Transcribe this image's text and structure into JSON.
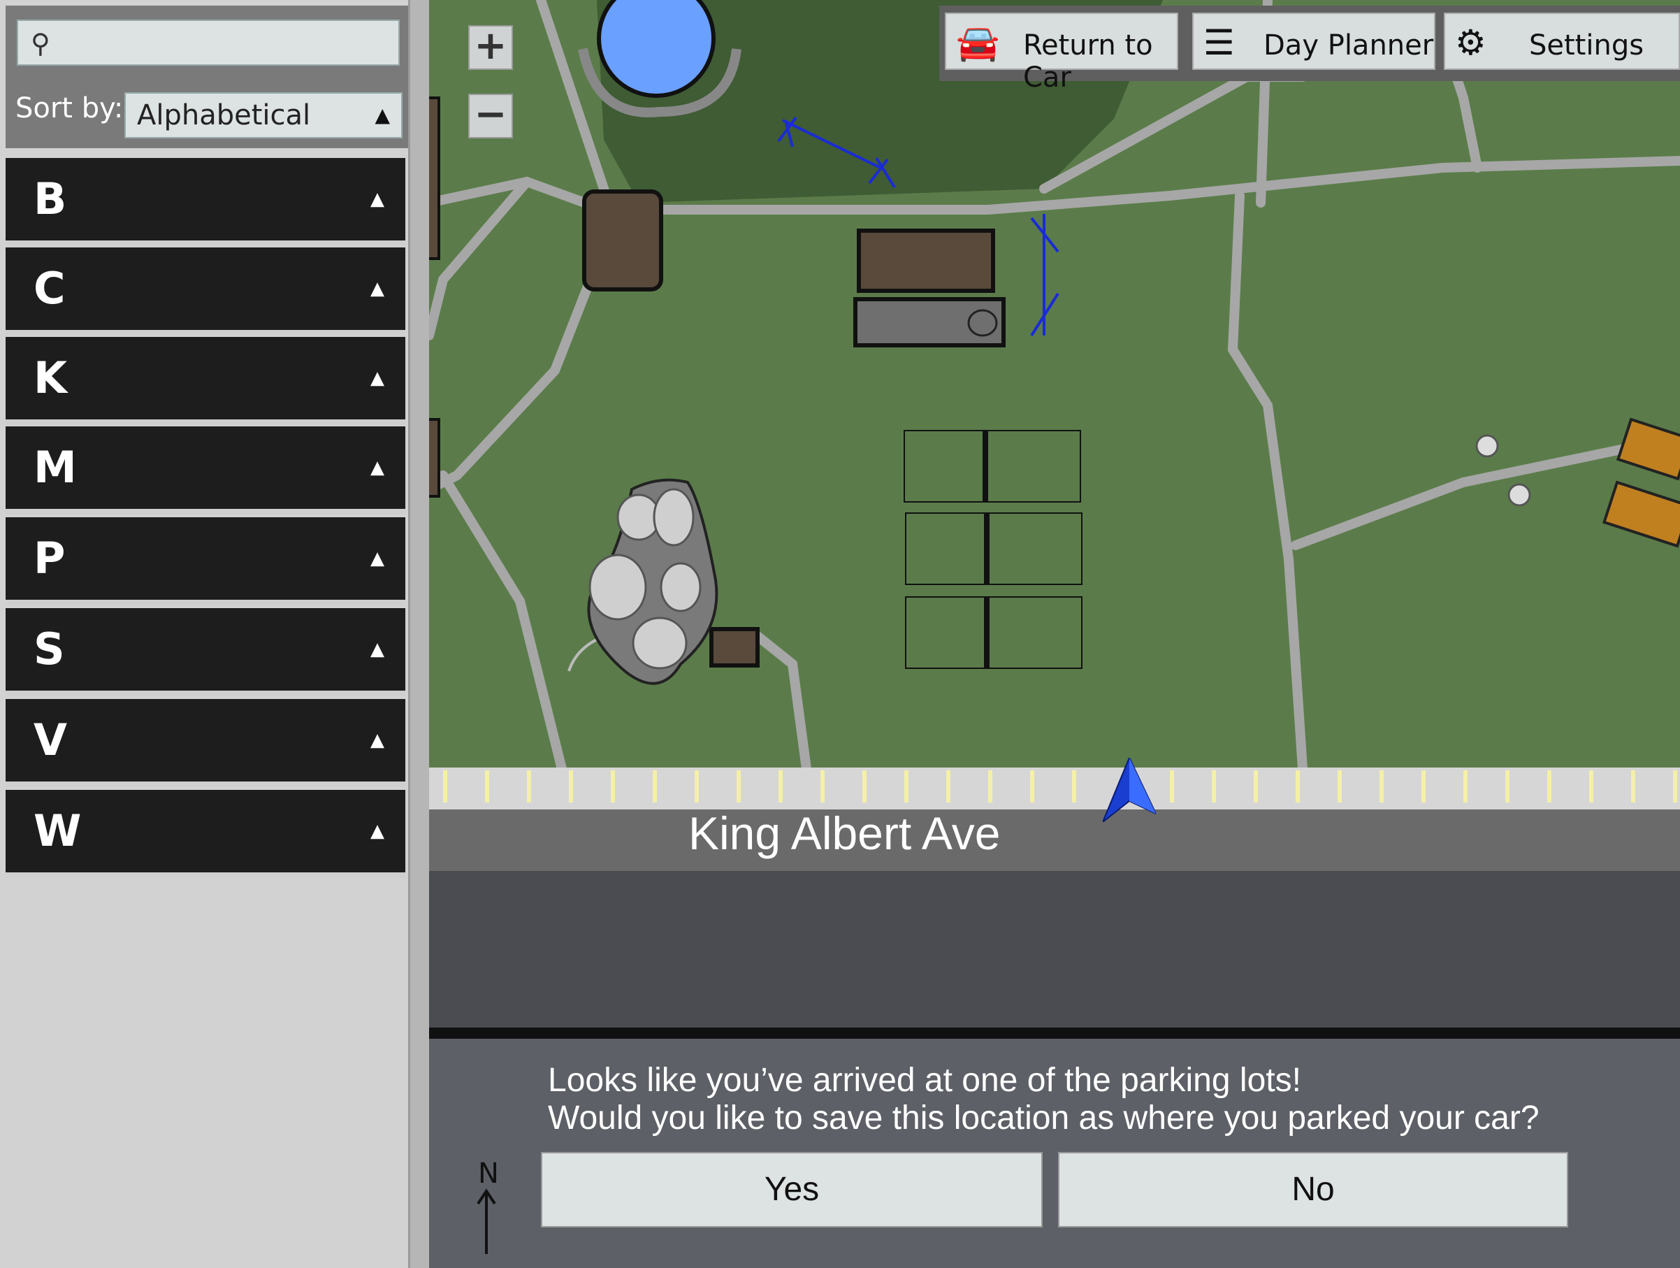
{
  "sidebar": {
    "search": {
      "placeholder": "",
      "value": ""
    },
    "sort": {
      "label": "Sort by:",
      "value": "Alphabetical"
    },
    "groups": [
      {
        "letter": "B"
      },
      {
        "letter": "C"
      },
      {
        "letter": "K"
      },
      {
        "letter": "M"
      },
      {
        "letter": "P"
      },
      {
        "letter": "S"
      },
      {
        "letter": "V"
      },
      {
        "letter": "W"
      }
    ]
  },
  "map": {
    "zoom_in": "+",
    "zoom_out": "−",
    "street_name": "King Albert Ave",
    "colors": {
      "grass": "#5b7c4a",
      "forest": "#3f5c34",
      "path": "#a7a7a7",
      "building": "#5a4a3c",
      "water": "#6aa0ff"
    }
  },
  "toolbar": {
    "return_to_car": "Return to Car",
    "day_planner": "Day Planner",
    "settings": "Settings"
  },
  "prompt": {
    "line1": "Looks like you’ve arrived at one of the parking lots!",
    "line2": "Would you like to save this location as where you parked your car?",
    "yes": "Yes",
    "no": "No"
  },
  "compass": {
    "label": "N"
  }
}
